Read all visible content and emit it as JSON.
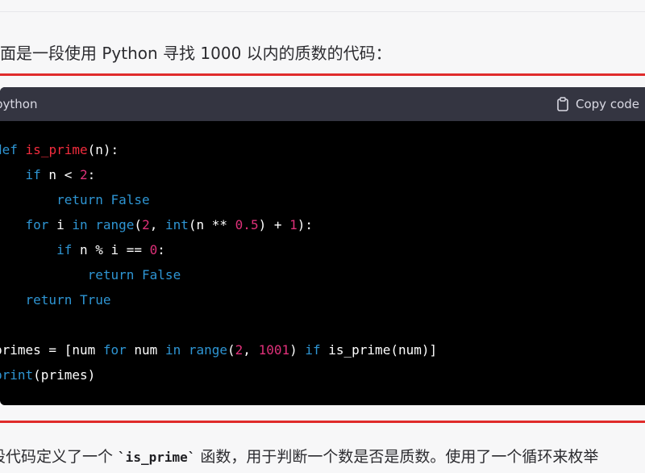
{
  "intro_text": "面是一段使用 Python 寻找 1000 以内的质数的代码：",
  "code_block": {
    "language": "python",
    "copy_label": "Copy code",
    "lines": [
      [
        {
          "t": "def",
          "c": "kw"
        },
        {
          "t": " ",
          "c": "plain"
        },
        {
          "t": "is_prime",
          "c": "fn"
        },
        {
          "t": "(n):",
          "c": "plain"
        }
      ],
      [
        {
          "t": "    ",
          "c": "plain"
        },
        {
          "t": "if",
          "c": "kw"
        },
        {
          "t": " n < ",
          "c": "plain"
        },
        {
          "t": "2",
          "c": "num"
        },
        {
          "t": ":",
          "c": "plain"
        }
      ],
      [
        {
          "t": "        ",
          "c": "plain"
        },
        {
          "t": "return",
          "c": "kw"
        },
        {
          "t": " ",
          "c": "plain"
        },
        {
          "t": "False",
          "c": "kw"
        }
      ],
      [
        {
          "t": "    ",
          "c": "plain"
        },
        {
          "t": "for",
          "c": "kw"
        },
        {
          "t": " i ",
          "c": "plain"
        },
        {
          "t": "in",
          "c": "kw"
        },
        {
          "t": " ",
          "c": "plain"
        },
        {
          "t": "range",
          "c": "kw"
        },
        {
          "t": "(",
          "c": "plain"
        },
        {
          "t": "2",
          "c": "num"
        },
        {
          "t": ", ",
          "c": "plain"
        },
        {
          "t": "int",
          "c": "kw"
        },
        {
          "t": "(n ** ",
          "c": "plain"
        },
        {
          "t": "0.5",
          "c": "num"
        },
        {
          "t": ") + ",
          "c": "plain"
        },
        {
          "t": "1",
          "c": "num"
        },
        {
          "t": "):",
          "c": "plain"
        }
      ],
      [
        {
          "t": "        ",
          "c": "plain"
        },
        {
          "t": "if",
          "c": "kw"
        },
        {
          "t": " n % i == ",
          "c": "plain"
        },
        {
          "t": "0",
          "c": "num"
        },
        {
          "t": ":",
          "c": "plain"
        }
      ],
      [
        {
          "t": "            ",
          "c": "plain"
        },
        {
          "t": "return",
          "c": "kw"
        },
        {
          "t": " ",
          "c": "plain"
        },
        {
          "t": "False",
          "c": "kw"
        }
      ],
      [
        {
          "t": "    ",
          "c": "plain"
        },
        {
          "t": "return",
          "c": "kw"
        },
        {
          "t": " ",
          "c": "plain"
        },
        {
          "t": "True",
          "c": "kw"
        }
      ],
      [],
      [
        {
          "t": "primes = [num ",
          "c": "plain"
        },
        {
          "t": "for",
          "c": "kw"
        },
        {
          "t": " num ",
          "c": "plain"
        },
        {
          "t": "in",
          "c": "kw"
        },
        {
          "t": " ",
          "c": "plain"
        },
        {
          "t": "range",
          "c": "kw"
        },
        {
          "t": "(",
          "c": "plain"
        },
        {
          "t": "2",
          "c": "num"
        },
        {
          "t": ", ",
          "c": "plain"
        },
        {
          "t": "1001",
          "c": "num"
        },
        {
          "t": ") ",
          "c": "plain"
        },
        {
          "t": "if",
          "c": "kw"
        },
        {
          "t": " is_prime(num)]",
          "c": "plain"
        }
      ],
      [
        {
          "t": "print",
          "c": "kw"
        },
        {
          "t": "(primes)",
          "c": "plain"
        }
      ]
    ]
  },
  "footer": {
    "before": "段代码定义了一个 ",
    "code": "`is_prime`",
    "after": " 函数，用于判断一个数是否是质数。使用了一个循环来枚举"
  },
  "colors": {
    "keyword": "#2e95d3",
    "function_name": "#f22c3d",
    "number": "#df3079",
    "highlight_rule": "#e02b2b",
    "code_background": "#000000",
    "code_header": "#343541"
  },
  "icons": {
    "copy": "clipboard-icon"
  }
}
